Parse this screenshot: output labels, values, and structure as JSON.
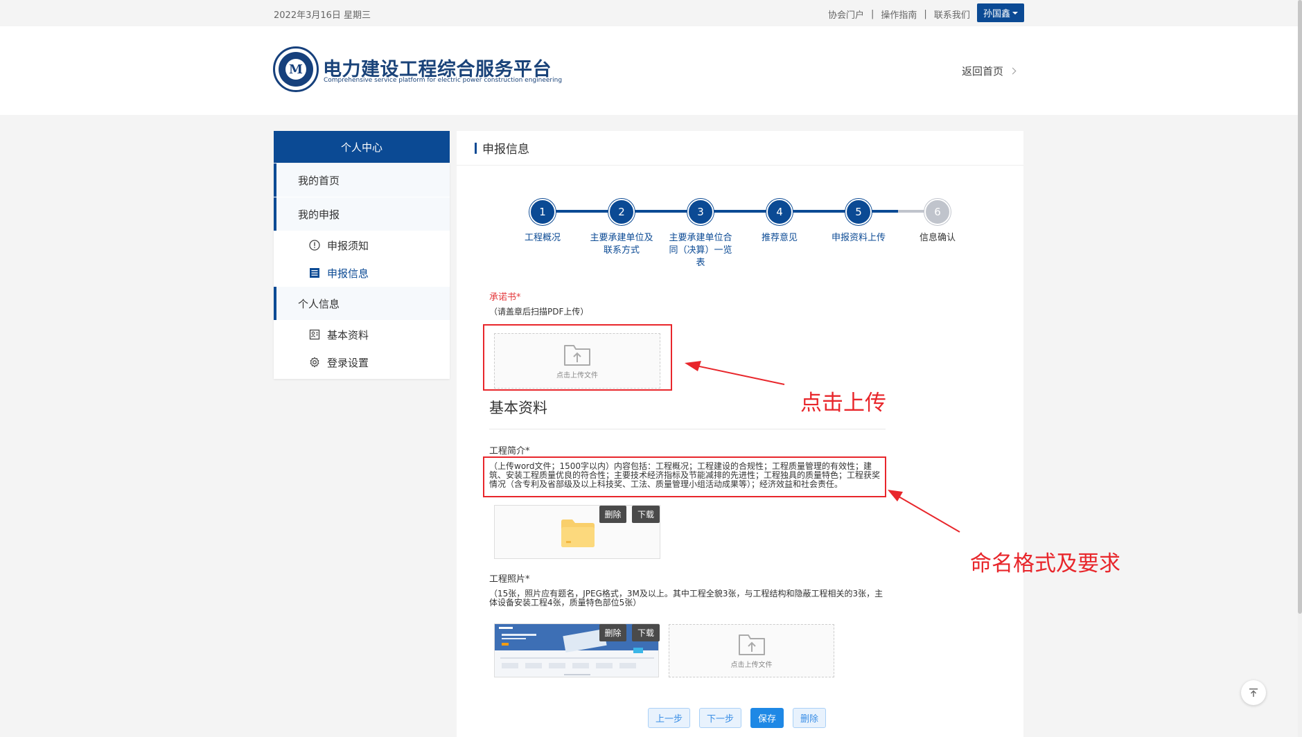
{
  "topbar": {
    "date": "2022年3月16日 星期三",
    "links": [
      "协会门户",
      "操作指南",
      "联系我们"
    ],
    "user": "孙国鑫"
  },
  "header": {
    "brand_cn": "电力建设工程综合服务平台",
    "brand_en": "Comprehensive service platform for electric power construction engineering",
    "back_home": "返回首页"
  },
  "sidebar": {
    "title": "个人中心",
    "items": [
      {
        "type": "group",
        "label": "我的首页"
      },
      {
        "type": "group",
        "label": "我的申报"
      },
      {
        "type": "sub",
        "label": "申报须知",
        "icon": "info-circle-icon"
      },
      {
        "type": "sub",
        "label": "申报信息",
        "icon": "list-icon",
        "active": true
      },
      {
        "type": "group",
        "label": "个人信息"
      },
      {
        "type": "sub",
        "label": "基本资料",
        "icon": "profile-card-icon"
      },
      {
        "type": "sub",
        "label": "登录设置",
        "icon": "gear-icon"
      }
    ]
  },
  "main": {
    "title": "申报信息",
    "steps": [
      {
        "num": "1",
        "label": "工程概况",
        "done": true
      },
      {
        "num": "2",
        "label": "主要承建单位及联系方式",
        "done": true
      },
      {
        "num": "3",
        "label": "主要承建单位合同（决算）一览表",
        "done": true
      },
      {
        "num": "4",
        "label": "推荐意见",
        "done": true
      },
      {
        "num": "5",
        "label": "申报资料上传",
        "done": true
      },
      {
        "num": "6",
        "label": "信息确认",
        "done": false
      }
    ],
    "pledge": {
      "label": "承诺书*",
      "note": "（请盖章后扫描PDF上传）",
      "upload_text": "点击上传文件"
    },
    "section_title": "基本资料",
    "intro": {
      "label": "工程简介*",
      "note": "（上传word文件；1500字以内）内容包括：工程概况；工程建设的合规性；工程质量管理的有效性；建筑、安装工程质量优良的符合性；主要技术经济指标及节能减排的先进性；工程独具的质量特色；工程获奖情况（含专利及省部级及以上科技奖、工法、质量管理小组活动成果等）；经济效益和社会责任。",
      "delete": "删除",
      "download": "下载"
    },
    "photos": {
      "label": "工程照片*",
      "note": "（15张，照片应有题名，JPEG格式，3M及以上。其中工程全貌3张，与工程结构和隐蔽工程相关的3张，主体设备安装工程4张，质量特色部位5张）",
      "delete": "删除",
      "download": "下载",
      "upload_text": "点击上传文件"
    },
    "buttons": {
      "prev": "上一步",
      "next": "下一步",
      "save": "保存",
      "delete": "删除"
    }
  },
  "annotations": {
    "upload": "点击上传",
    "naming": "命名格式及要求"
  },
  "colors": {
    "primary": "#0b4a94",
    "annotation_red": "#e8262b",
    "button_blue": "#1e88e5"
  }
}
